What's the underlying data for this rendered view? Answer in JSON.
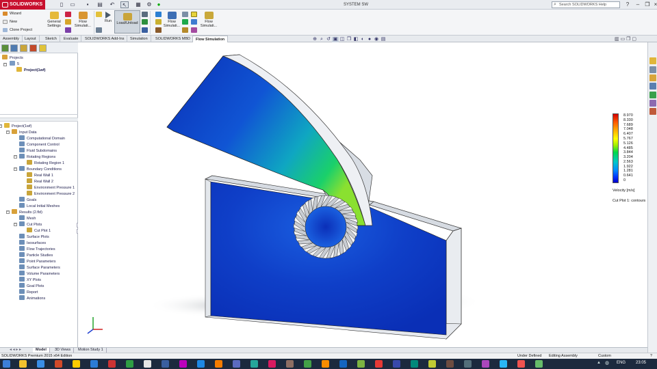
{
  "app": {
    "brand": "SOLIDWORKS",
    "window_title": "SYSTEM SW",
    "help_search_placeholder": "Search SOLIDWORKS Help"
  },
  "ribbon": {
    "wizard": "Wizard",
    "new": "New",
    "clone_project": "Clone Project",
    "general_settings": [
      "General",
      "Settings"
    ],
    "flow_simulation_1": [
      "Flow",
      "Simulati..."
    ],
    "run": "Run",
    "load_unload": "Load/Unload",
    "flow_simulation_2": [
      "Flow",
      "Simulati..."
    ],
    "flow_simulation_3": [
      "Flow",
      "Simulati..."
    ]
  },
  "tabs": [
    "Assembly",
    "Layout",
    "Sketch",
    "Evaluate",
    "SOLIDWORKS Add-Ins",
    "Simulation",
    "SOLIDWORKS MBD",
    "Flow Simulation"
  ],
  "active_tab": "Flow Simulation",
  "projects_tree": {
    "root": "Projects",
    "item": "5",
    "project": "Project(1wf)"
  },
  "analysis_tree": [
    {
      "label": "Project(1wf)",
      "level": 0
    },
    {
      "label": "Input Data",
      "level": 1
    },
    {
      "label": "Computational Domain",
      "level": 2
    },
    {
      "label": "Component Control",
      "level": 2
    },
    {
      "label": "Fluid Subdomains",
      "level": 2
    },
    {
      "label": "Rotating Regions",
      "level": 2
    },
    {
      "label": "Rotating Region 1",
      "level": 3
    },
    {
      "label": "Boundary Conditions",
      "level": 2
    },
    {
      "label": "Real Wall 1",
      "level": 3
    },
    {
      "label": "Real Wall 2",
      "level": 3
    },
    {
      "label": "Environment Pressure 1",
      "level": 3
    },
    {
      "label": "Environment Pressure 2",
      "level": 3
    },
    {
      "label": "Goals",
      "level": 2
    },
    {
      "label": "Local Initial Meshes",
      "level": 2
    },
    {
      "label": "Results (2.fld)",
      "level": 1
    },
    {
      "label": "Mesh",
      "level": 2
    },
    {
      "label": "Cut Plots",
      "level": 2
    },
    {
      "label": "Cut Plot 1",
      "level": 3
    },
    {
      "label": "Surface Plots",
      "level": 2
    },
    {
      "label": "Isosurfaces",
      "level": 2
    },
    {
      "label": "Flow Trajectories",
      "level": 2
    },
    {
      "label": "Particle Studies",
      "level": 2
    },
    {
      "label": "Point Parameters",
      "level": 2
    },
    {
      "label": "Surface Parameters",
      "level": 2
    },
    {
      "label": "Volume Parameters",
      "level": 2
    },
    {
      "label": "XY Plots",
      "level": 2
    },
    {
      "label": "Goal Plots",
      "level": 2
    },
    {
      "label": "Report",
      "level": 2
    },
    {
      "label": "Animations",
      "level": 2
    }
  ],
  "legend": {
    "values": [
      "8.970",
      "8.330",
      "7.689",
      "7.048",
      "6.407",
      "5.767",
      "5.126",
      "4.485",
      "3.844",
      "3.204",
      "2.563",
      "1.922",
      "1.281",
      "0.641",
      "0"
    ],
    "unit": "Velocity [m/s]",
    "caption": "Cut Plot 1: contours"
  },
  "bottom_tabs": [
    "Model",
    "3D Views",
    "Motion Study 1"
  ],
  "status": {
    "edition": "SOLIDWORKS Premium 2015 x64 Edition",
    "state": "Under Defined",
    "mode": "Editing Assembly",
    "units": "Custom"
  },
  "taskbar": {
    "language": "ENG",
    "clock": "23:05"
  },
  "colors": {
    "brand_red": "#c8102e",
    "model_blue": "#1446c8",
    "model_cyan": "#14b4c8"
  }
}
